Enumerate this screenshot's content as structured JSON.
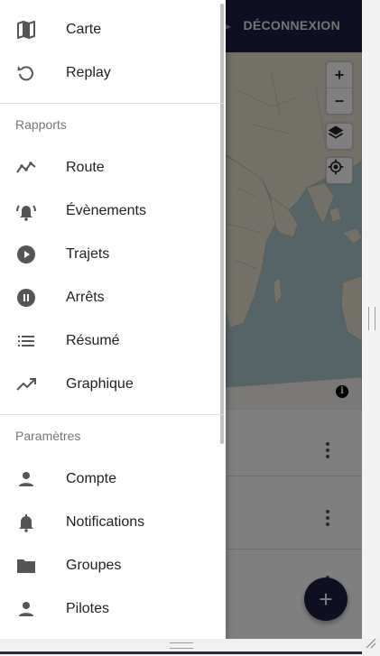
{
  "topbar": {
    "logout_label": "DÉCONNEXION"
  },
  "map": {
    "zoom_in_label": "+",
    "zoom_out_label": "−",
    "info_label": "i"
  },
  "fab": {
    "label": "+"
  },
  "drawer": {
    "main_items": [
      {
        "label": "Carte",
        "icon": "map-icon"
      },
      {
        "label": "Replay",
        "icon": "replay-icon"
      }
    ],
    "reports_header": "Rapports",
    "report_items": [
      {
        "label": "Route",
        "icon": "route-icon"
      },
      {
        "label": "Évènements",
        "icon": "notifications-active-icon"
      },
      {
        "label": "Trajets",
        "icon": "play-circle-icon"
      },
      {
        "label": "Arrêts",
        "icon": "pause-circle-icon"
      },
      {
        "label": "Résumé",
        "icon": "list-icon"
      },
      {
        "label": "Graphique",
        "icon": "trending-up-icon"
      }
    ],
    "settings_header": "Paramètres",
    "settings_items": [
      {
        "label": "Compte",
        "icon": "person-icon"
      },
      {
        "label": "Notifications",
        "icon": "bell-icon"
      },
      {
        "label": "Groupes",
        "icon": "folder-icon"
      },
      {
        "label": "Pilotes",
        "icon": "person-icon"
      }
    ]
  },
  "colors": {
    "primary": "#1f1f47",
    "map_water": "#a9c8cf",
    "map_land": "#e8e2d3"
  }
}
